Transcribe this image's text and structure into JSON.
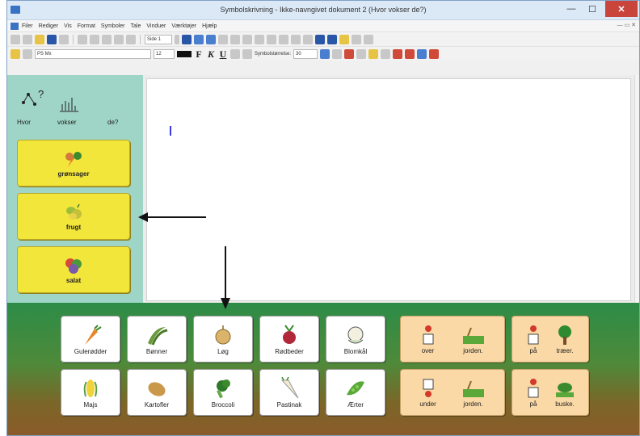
{
  "window": {
    "title": "Symbolskrivning - Ikke-navngivet dokument 2 (Hvor vokser de?)",
    "controls": {
      "minimize": "—",
      "maximize": "☐",
      "close": "✕"
    }
  },
  "menubar": {
    "items": [
      "Filer",
      "Rediger",
      "Vis",
      "Format",
      "Symboler",
      "Tale",
      "Vinduer",
      "Værktøjer",
      "Hjælp"
    ]
  },
  "toolbar": {
    "page_field": "Side 1",
    "font_name": "PS Mx",
    "font_size": "12",
    "bold": "F",
    "italic": "K",
    "underline": "U",
    "symbol_size_label": "Symbolstørrelse:",
    "symbol_size_value": "30"
  },
  "left_panel": {
    "header_words": [
      "Hvor",
      "vokser",
      "de?"
    ],
    "categories": [
      {
        "label": "grønsager",
        "icon": "vegetables-icon"
      },
      {
        "label": "frugt",
        "icon": "fruit-icon"
      },
      {
        "label": "salat",
        "icon": "salad-icon"
      }
    ]
  },
  "grid": {
    "row1": [
      "Gulerødder",
      "Bønner",
      "Løg",
      "Rødbeder",
      "Blomkål"
    ],
    "row2": [
      "Majs",
      "Kartofler",
      "Broccoli",
      "Pastinak",
      "Ærter"
    ],
    "phrases": {
      "over_jorden": [
        "over",
        "jorden."
      ],
      "paa_traeer": [
        "på",
        "træer."
      ],
      "under_jorden": [
        "under",
        "jorden."
      ],
      "paa_buske": [
        "på",
        "buske."
      ]
    }
  },
  "colors": {
    "category_button": "#f3e63b",
    "left_panel": "#9fd5c6",
    "phrase_button": "#fad9a6",
    "grid_top": "#2c8c47",
    "grid_bottom": "#8c5a2a"
  }
}
